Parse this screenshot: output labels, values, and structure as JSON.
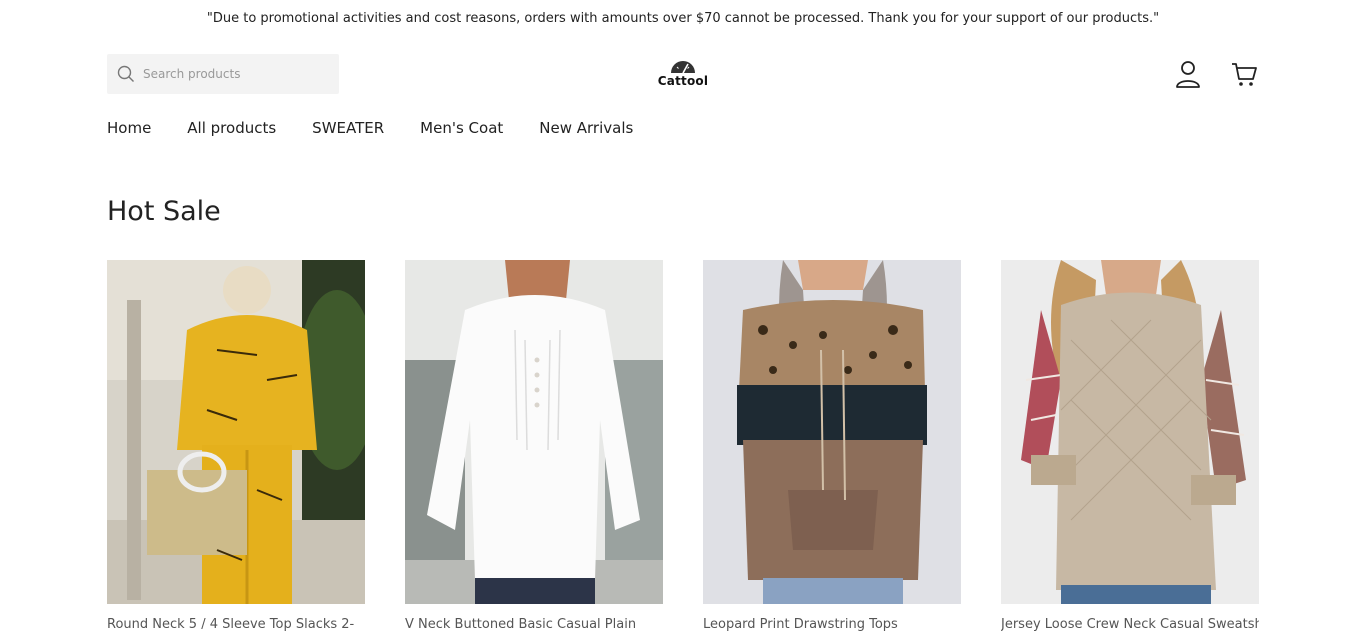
{
  "announcement": "\"Due to promotional activities and cost reasons, orders with amounts over $70 cannot be processed. Thank you for your support of our products.\"",
  "search": {
    "placeholder": "Search products"
  },
  "brand": {
    "name": "Cattool"
  },
  "header_icons": {
    "account": "user-icon",
    "cart": "cart-icon"
  },
  "nav": {
    "items": [
      {
        "label": "Home"
      },
      {
        "label": "All products"
      },
      {
        "label": "SWEATER"
      },
      {
        "label": "Men's Coat"
      },
      {
        "label": "New Arrivals"
      }
    ]
  },
  "section": {
    "title": "Hot Sale"
  },
  "products": [
    {
      "name": "Round Neck 5 / 4 Sleeve Top Slacks 2-"
    },
    {
      "name": "V Neck Buttoned Basic Casual Plain"
    },
    {
      "name": "Leopard Print Drawstring Tops"
    },
    {
      "name": "Jersey Loose Crew Neck Casual Sweatshirt"
    }
  ],
  "colors": {
    "text": "#222222",
    "search_bg": "#f3f3f3"
  }
}
